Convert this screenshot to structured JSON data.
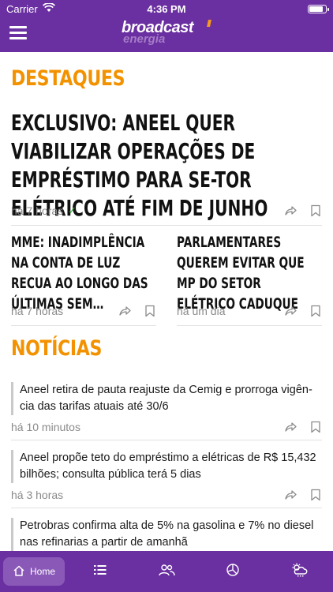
{
  "status_bar": {
    "carrier": "Carrier",
    "time": "4:36 PM",
    "battery_level": 0.9
  },
  "header": {
    "logo_main": "broadcast",
    "logo_sub": "energia"
  },
  "sections": {
    "highlights_title": "DESTAQUES",
    "news_title": "NOTÍCIAS"
  },
  "featured": {
    "headline": "EXCLUSIVO: ANEEL QUER VIABILIZAR OPERAÇÕES DE EMPRÉSTIMO PARA SE-TOR ELÉTRICO ATÉ FIM DE JUNHO",
    "time": "há 7 horas",
    "read": true
  },
  "highlights": [
    {
      "headline": "MME: INADIMPLÊNCIA NA CONTA DE LUZ RECUA AO LONGO DAS ÚLTIMAS SEM…",
      "time": "há 7 horas"
    },
    {
      "headline": "PARLAMENTARES QUEREM EVITAR QUE MP DO SETOR ELÉTRICO CADUQUE",
      "time": "há um dia"
    }
  ],
  "news": [
    {
      "text": "Aneel retira de pauta reajuste da Cemig e prorroga vigên-cia das tarifas atuais até 30/6",
      "time": "há 10 minutos"
    },
    {
      "text": "Aneel propõe teto do empréstimo a elétricas de R$ 15,432 bilhões; consulta pública terá 5 dias",
      "time": "há 3 horas"
    },
    {
      "text": "Petrobras confirma alta de 5% na gasolina e 7% no diesel nas refinarias a partir de amanhã",
      "time": ""
    }
  ],
  "tab_bar": {
    "home_label": "Home",
    "icons": [
      "home-icon",
      "list-icon",
      "people-icon",
      "pie-chart-icon",
      "weather-icon"
    ]
  },
  "colors": {
    "brand_purple": "#6a2fa0",
    "accent_orange": "#f39200",
    "tab_active": "#8a59b8"
  }
}
